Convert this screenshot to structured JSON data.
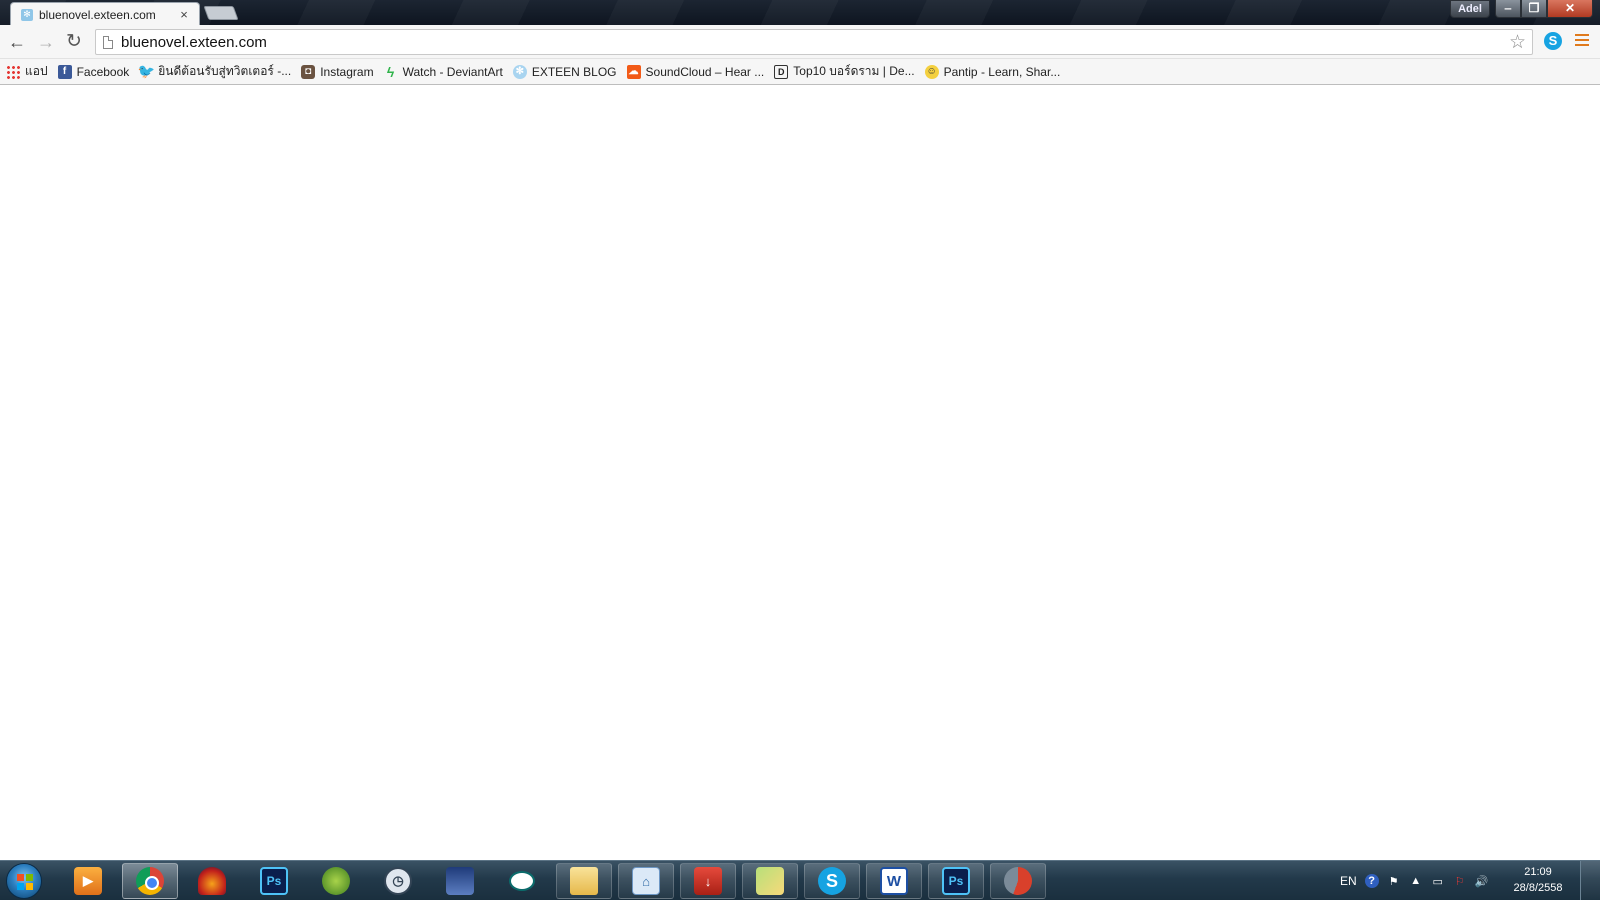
{
  "browser": {
    "tab": {
      "title": "bluenovel.exteen.com",
      "close_glyph": "×"
    },
    "profile_name": "Adel",
    "window_controls": {
      "minimize": "‒",
      "maximize": "❐",
      "close": "✕"
    }
  },
  "toolbar": {
    "back_glyph": "←",
    "forward_glyph": "→",
    "reload_glyph": "↻",
    "url": "bluenovel.exteen.com",
    "star_glyph": "☆",
    "skype_ext_glyph": "S"
  },
  "bookmarks": [
    {
      "label": "แอป",
      "icon": "apps-icon"
    },
    {
      "label": "Facebook",
      "icon": "facebook-icon",
      "glyph": "f"
    },
    {
      "label": "ยินดีต้อนรับสู่ทวิตเตอร์ -...",
      "icon": "twitter-icon",
      "glyph": "🐦"
    },
    {
      "label": "Instagram",
      "icon": "instagram-icon",
      "glyph": "◘"
    },
    {
      "label": "Watch - DeviantArt",
      "icon": "deviantart-icon",
      "glyph": "ϟ"
    },
    {
      "label": "EXTEEN BLOG",
      "icon": "exteen-icon",
      "glyph": "✻"
    },
    {
      "label": "SoundCloud – Hear ...",
      "icon": "soundcloud-icon",
      "glyph": "☁"
    },
    {
      "label": "Top10 บอร์ดราม | De...",
      "icon": "dek-d-icon",
      "glyph": "D"
    },
    {
      "label": "Pantip - Learn, Shar...",
      "icon": "pantip-icon",
      "glyph": "☺"
    }
  ],
  "taskbar": {
    "apps": [
      {
        "name": "media-player",
        "glyph": "▶"
      },
      {
        "name": "chrome",
        "glyph": ""
      },
      {
        "name": "audition",
        "glyph": ""
      },
      {
        "name": "photoshop-pinned",
        "glyph": "Ps"
      },
      {
        "name": "globe-app",
        "glyph": ""
      },
      {
        "name": "clock-app",
        "glyph": "◷"
      },
      {
        "name": "anime-app",
        "glyph": ""
      },
      {
        "name": "chat-app",
        "glyph": ""
      },
      {
        "name": "file-explorer",
        "glyph": ""
      },
      {
        "name": "network-app",
        "glyph": "⌂"
      },
      {
        "name": "download-app",
        "glyph": "↓"
      },
      {
        "name": "sticky-notes",
        "glyph": ""
      },
      {
        "name": "skype",
        "glyph": "S"
      },
      {
        "name": "word",
        "glyph": "W"
      },
      {
        "name": "photoshop",
        "glyph": "Ps"
      },
      {
        "name": "snagit",
        "glyph": ""
      }
    ],
    "tray": {
      "language": "EN",
      "help_glyph": "?",
      "flag_glyph": "⚑",
      "arrow_glyph": "▲",
      "network_glyph": "▭",
      "action_glyph": "⚐",
      "volume_glyph": "🔊"
    },
    "clock": {
      "time": "21:09",
      "date": "28/8/2558"
    }
  }
}
